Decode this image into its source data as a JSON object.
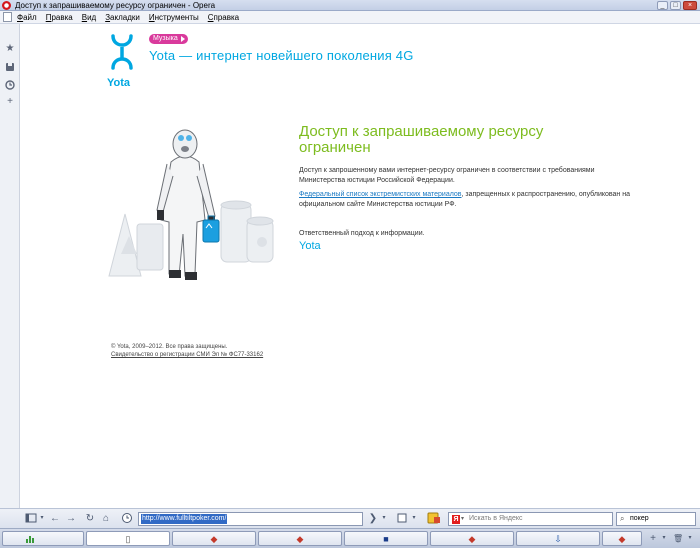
{
  "window": {
    "title": "Доступ к запрашиваемому ресурсу ограничен - Opera",
    "minimize_label": "_",
    "maximize_label": "□",
    "close_label": "×"
  },
  "menu": {
    "items": [
      "Файл",
      "Правка",
      "Вид",
      "Закладки",
      "Инструменты",
      "Справка"
    ]
  },
  "side_panel": {
    "icons": [
      "star-icon",
      "save-icon",
      "history-icon",
      "plus-icon"
    ]
  },
  "page": {
    "logo_text": "Yota",
    "music_badge": "Музыка",
    "tagline": "Yota — интернет новейшего поколения 4G",
    "headline": "Доступ к запрашиваемому ресурсу ограничен",
    "paragraph1": "Доступ к запрошенному вами интернет-ресурсу ограничен в соответствии с требованиями Министерства юстиции Российской Федерации.",
    "paragraph2_link": "Федеральный список экстремистских материалов",
    "paragraph2_rest": ", запрещенных к распространению, опубликован на официальном сайте Министерства юстиции РФ.",
    "paragraph3": "Ответственный подход к информации.",
    "signature": "Yota",
    "copyright": "© Yota, 2009–2012. Все права защищены.",
    "registration_link": "Свидетельство о регистрации СМИ Эл № ФС77-33162"
  },
  "toolbar": {
    "address_url": "http://www.fulltiltpoker.com/",
    "search_placeholder": "Искать в Яндекс",
    "search_engine_letter": "Я",
    "quick_search_value": "покер"
  },
  "colors": {
    "brand_blue": "#00a7e1",
    "headline_green": "#7dbc1f",
    "badge_pink": "#d93a9c",
    "link_blue": "#1979c3"
  }
}
